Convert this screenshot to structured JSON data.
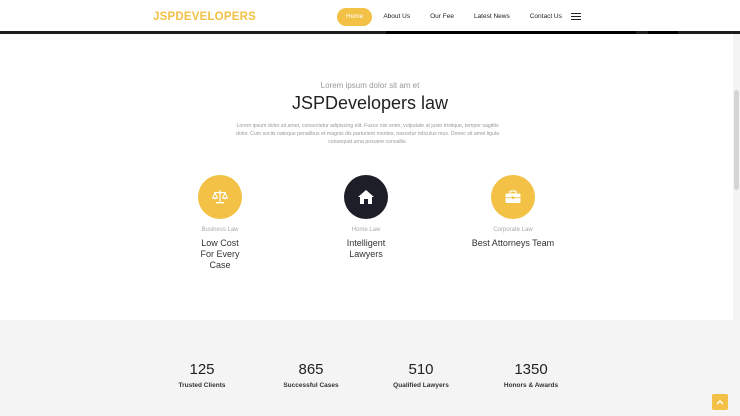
{
  "header": {
    "logo": "JSPDEVELOPERS",
    "nav": [
      {
        "label": "Home",
        "active": true
      },
      {
        "label": "About Us",
        "active": false
      },
      {
        "label": "Our Fee",
        "active": false
      },
      {
        "label": "Latest News",
        "active": false
      },
      {
        "label": "Contact Us",
        "active": false
      }
    ],
    "menu_icon": "hamburger-icon"
  },
  "intro": {
    "subtitle": "Lorem ipsum dolor sit am et",
    "title": "JSPDevelopers law",
    "text": "Lorem ipsum dolor sit amet, consectetur adipiscing elit. Fusce nisi enim, vulputate at justo tristique, tempor sagittis dolor. Cum sociis natoque penatibus et magnis dis parturient montes, nascetur ridiculus mus. Donec sit amet ligula consequat urna posuere convallis."
  },
  "features": [
    {
      "icon": "scale-icon",
      "label": "Business Law",
      "title": "Low Cost For Every Case",
      "color": "#f2c145"
    },
    {
      "icon": "home-icon",
      "label": "Home Law",
      "title": "Intelligent Lawyers",
      "color": "#1e1e28"
    },
    {
      "icon": "briefcase-icon",
      "label": "Corporate Law",
      "title": "Best Attorneys Team",
      "color": "#f2c145"
    }
  ],
  "stats": [
    {
      "value": "125",
      "label": "Trusted Clients"
    },
    {
      "value": "865",
      "label": "Successful Cases"
    },
    {
      "value": "510",
      "label": "Qualified Lawyers"
    },
    {
      "value": "1350",
      "label": "Honors & Awards"
    }
  ],
  "colors": {
    "accent": "#f2c145",
    "dark": "#1e1e28",
    "stats_bg": "#f4f4f4"
  },
  "scroll_top_icon": "chevron-up-icon"
}
